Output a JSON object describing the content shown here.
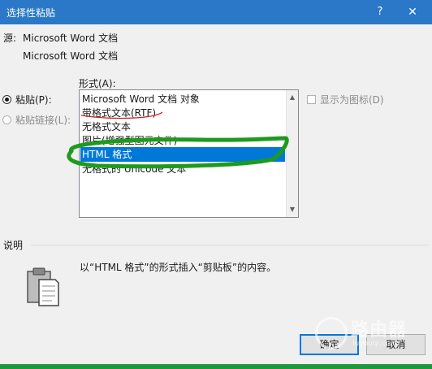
{
  "window": {
    "title": "选择性粘贴",
    "help": "?",
    "close": "✕"
  },
  "source": {
    "label": "源:",
    "line1": "Microsoft Word 文档",
    "line2": "Microsoft Word 文档"
  },
  "format_label": "形式(A):",
  "options": {
    "paste": "粘贴(P):",
    "paste_link": "粘贴链接(L):"
  },
  "formats": [
    "Microsoft Word 文档 对象",
    "带格式文本(RTF)",
    "无格式文本",
    "图片(增强型图元文件)",
    "HTML 格式",
    "无格式的 Unicode 文本"
  ],
  "selected_format_index": 4,
  "show_as_icon": "显示为图标(D)",
  "description": {
    "label": "说明",
    "text": "以“HTML 格式”的形式插入“剪贴板”的内容。"
  },
  "buttons": {
    "ok": "确定",
    "cancel": "取消"
  },
  "watermark": {
    "text": "路由器",
    "url": "luyouqi.com"
  },
  "colors": {
    "titlebar": "#2b78c8",
    "selection": "#0078d7",
    "highlight_green": "#1e9a1e",
    "highlight_red": "#c81e1e"
  }
}
